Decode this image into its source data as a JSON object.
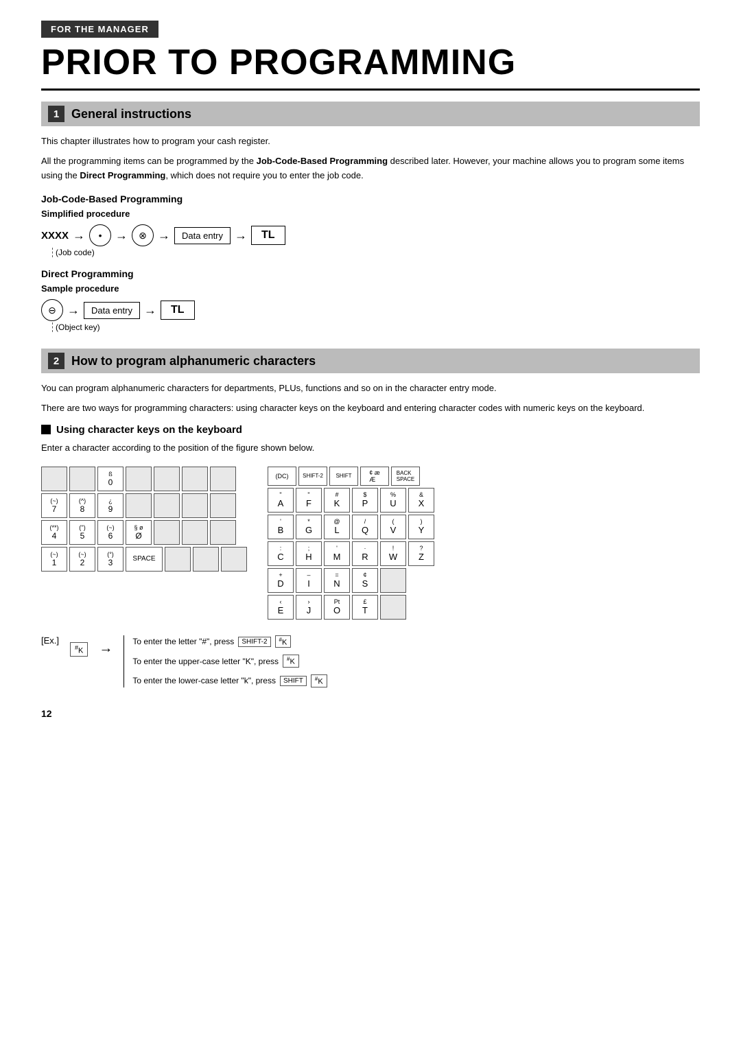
{
  "badge": "FOR THE MANAGER",
  "title": "PRIOR TO PROGRAMMING",
  "section1": {
    "number": "1",
    "title": "General instructions",
    "para1": "This chapter illustrates how to program your cash register.",
    "para2": "All the programming items can be programmed by the Job-Code-Based Programming described later.",
    "para2_suffix": "However, your machine allows you to program some items using the Direct Programming, which does not require you to enter the job code.",
    "subsection1_title": "Job-Code-Based Programming",
    "simplified_label": "Simplified procedure",
    "xxxx": "XXXX",
    "dot_symbol": "•",
    "otimes_symbol": "⊗",
    "data_entry": "Data entry",
    "tl": "TL",
    "job_code_note": "(Job code)",
    "direct_title": "Direct Programming",
    "sample_label": "Sample procedure",
    "ominus_symbol": "⊖",
    "object_key_note": "(Object key)"
  },
  "section2": {
    "number": "2",
    "title": "How to program alphanumeric characters",
    "para1": "You can program alphanumeric characters for departments, PLUs, functions and so on in the character entry mode.",
    "para2": "There are two ways for programming characters: using character keys on the keyboard and entering character codes with numeric keys on the keyboard.",
    "using_keys_title": "Using character keys on the keyboard",
    "enter_char_text": "Enter a character according to the position of the figure shown below."
  },
  "keyboard": {
    "left": {
      "rows": [
        [
          "",
          "",
          "ß 0",
          "",
          "",
          "",
          ""
        ],
        [
          "(~) 7",
          "(^) 8",
          "¿ 9",
          "",
          "",
          "",
          ""
        ],
        [
          "(**) 4",
          "('') 5",
          "(~) 6",
          "§ ø Ø",
          "",
          "",
          ""
        ],
        [
          "(~) 1",
          "(~) 2",
          "(°) 3",
          "SPACE",
          "",
          "",
          ""
        ]
      ]
    },
    "right": {
      "top_row": [
        "(DC)",
        "SHIFT-2",
        "SHIFT",
        "¢ æ Æ",
        "BACK SPACE"
      ],
      "rows": [
        [
          {
            "sup": "\"",
            "main": "A"
          },
          {
            "sup": "\"",
            "main": "F"
          },
          {
            "sup": "#",
            "main": "K"
          },
          {
            "sup": "$",
            "main": "P"
          },
          {
            "sup": "%",
            "main": "U"
          },
          {
            "sup": "&",
            "main": "X"
          }
        ],
        [
          {
            "sup": "'",
            "main": "B"
          },
          {
            "sup": "*",
            "main": "G"
          },
          {
            "sup": "@",
            "main": "L"
          },
          {
            "sup": "/",
            "main": "Q"
          },
          {
            "sup": "(",
            "main": "V"
          },
          {
            "sup": ")",
            "main": "Y"
          }
        ],
        [
          {
            "sup": ":",
            "main": "C"
          },
          {
            "sup": ";",
            "main": "H"
          },
          {
            "sup": "'",
            "main": "M"
          },
          {
            "sup": "·",
            "main": "R"
          },
          {
            "sup": "!",
            "main": "W"
          },
          {
            "sup": "?",
            "main": "Z"
          }
        ],
        [
          {
            "sup": "+",
            "main": "D"
          },
          {
            "sup": "–",
            "main": "I"
          },
          {
            "sup": "=",
            "main": "N"
          },
          {
            "sup": "¢",
            "main": "S"
          },
          {
            "sup": "",
            "main": ""
          }
        ],
        [
          {
            "sup": "‹",
            "main": "E"
          },
          {
            "sup": "›",
            "main": "J"
          },
          {
            "sup": "Pt",
            "main": "O"
          },
          {
            "sup": "£",
            "main": "T"
          },
          {
            "sup": "",
            "main": ""
          }
        ]
      ]
    }
  },
  "example": {
    "label": "[Ex.]",
    "k_key": "# K",
    "lines": [
      "To enter the letter \"#\", press SHIFT-2  # K",
      "To enter the upper-case letter \"K\", press  # K",
      "To enter the lower-case letter \"k\", press SHIFT  # K"
    ]
  },
  "footer": {
    "page_number": "12"
  }
}
